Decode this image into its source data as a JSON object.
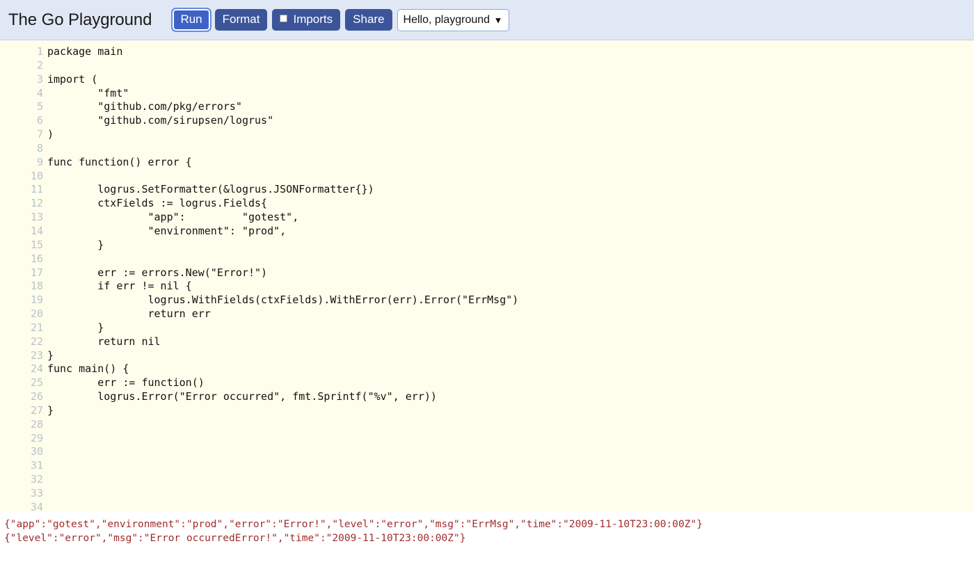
{
  "header": {
    "title": "The Go Playground",
    "buttons": [
      {
        "name": "run-button",
        "label": "Run",
        "focused": true,
        "checkbox": false
      },
      {
        "name": "format-button",
        "label": "Format",
        "focused": false,
        "checkbox": false
      },
      {
        "name": "imports-button",
        "label": "Imports",
        "focused": false,
        "checkbox": true
      },
      {
        "name": "share-button",
        "label": "Share",
        "focused": false,
        "checkbox": false
      }
    ],
    "example_select": {
      "selected": "Hello, playground",
      "options": [
        "Hello, playground"
      ],
      "caret_icon": "chevron-down-icon"
    },
    "colors": {
      "header_bg": "#e0e8f5",
      "button_bg": "#3c5499",
      "button_focus_bg": "#3f62c4"
    }
  },
  "editor": {
    "background": "#fffeec",
    "line_number_color": "#b7c3c9",
    "code_color": "#111111",
    "total_visible_lines": 34,
    "lines": [
      {
        "n": "1",
        "text": "package main"
      },
      {
        "n": "2",
        "text": ""
      },
      {
        "n": "3",
        "text": "import ("
      },
      {
        "n": "4",
        "text": "        \"fmt\""
      },
      {
        "n": "5",
        "text": "        \"github.com/pkg/errors\""
      },
      {
        "n": "6",
        "text": "        \"github.com/sirupsen/logrus\""
      },
      {
        "n": "7",
        "text": ")"
      },
      {
        "n": "8",
        "text": ""
      },
      {
        "n": "9",
        "text": "func function() error {"
      },
      {
        "n": "10",
        "text": ""
      },
      {
        "n": "11",
        "text": "        logrus.SetFormatter(&logrus.JSONFormatter{})"
      },
      {
        "n": "12",
        "text": "        ctxFields := logrus.Fields{"
      },
      {
        "n": "13",
        "text": "                \"app\":         \"gotest\","
      },
      {
        "n": "14",
        "text": "                \"environment\": \"prod\","
      },
      {
        "n": "15",
        "text": "        }"
      },
      {
        "n": "16",
        "text": ""
      },
      {
        "n": "17",
        "text": "        err := errors.New(\"Error!\")"
      },
      {
        "n": "18",
        "text": "        if err != nil {"
      },
      {
        "n": "19",
        "text": "                logrus.WithFields(ctxFields).WithError(err).Error(\"ErrMsg\")"
      },
      {
        "n": "20",
        "text": "                return err"
      },
      {
        "n": "21",
        "text": "        }"
      },
      {
        "n": "22",
        "text": "        return nil"
      },
      {
        "n": "23",
        "text": "}"
      },
      {
        "n": "24",
        "text": "func main() {"
      },
      {
        "n": "25",
        "text": "        err := function()"
      },
      {
        "n": "26",
        "text": "        logrus.Error(\"Error occurred\", fmt.Sprintf(\"%v\", err))"
      },
      {
        "n": "27",
        "text": "}"
      },
      {
        "n": "28",
        "text": ""
      },
      {
        "n": "29",
        "text": ""
      },
      {
        "n": "30",
        "text": ""
      },
      {
        "n": "31",
        "text": ""
      },
      {
        "n": "32",
        "text": ""
      },
      {
        "n": "33",
        "text": ""
      },
      {
        "n": "34",
        "text": ""
      }
    ]
  },
  "output": {
    "text_color": "#a02c2c",
    "lines": [
      "{\"app\":\"gotest\",\"environment\":\"prod\",\"error\":\"Error!\",\"level\":\"error\",\"msg\":\"ErrMsg\",\"time\":\"2009-11-10T23:00:00Z\"}",
      "{\"level\":\"error\",\"msg\":\"Error occurredError!\",\"time\":\"2009-11-10T23:00:00Z\"}"
    ]
  }
}
